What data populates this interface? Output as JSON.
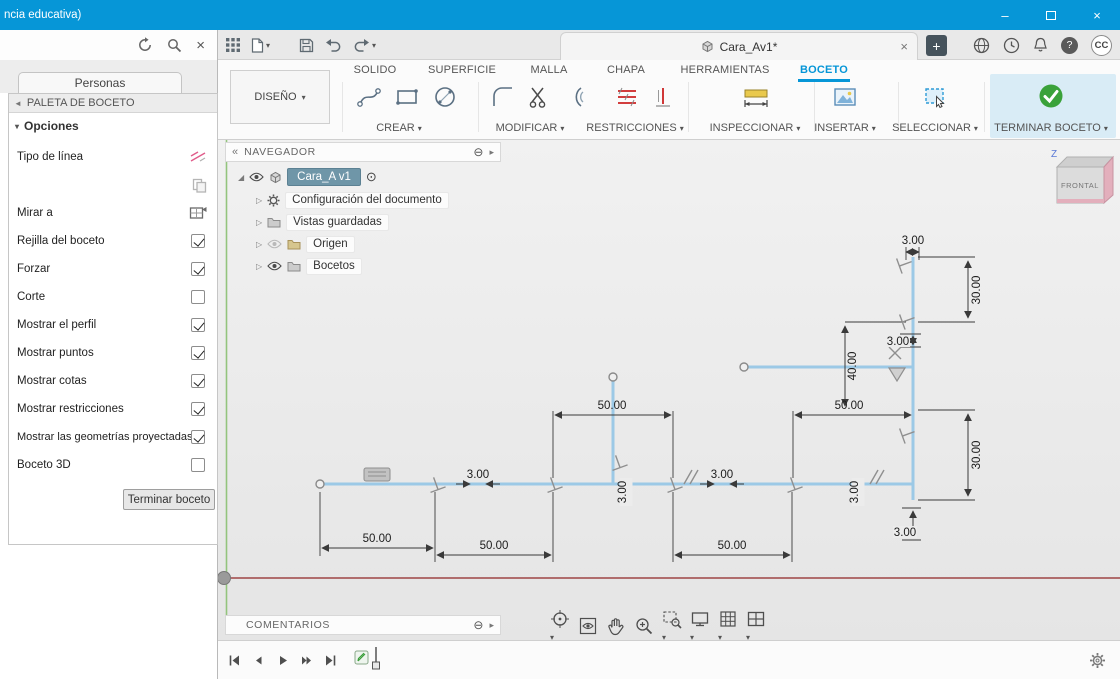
{
  "window": {
    "title": "ncia educativa)"
  },
  "left_panel": {
    "people_tab": "Personas",
    "palette": {
      "header": "PALETA DE BOCETO",
      "section": "Opciones",
      "rows": [
        {
          "label": "Tipo de línea",
          "type": "icon",
          "icon": "line-type-icon"
        },
        {
          "label": "",
          "type": "icon",
          "icon": "construction-icon"
        },
        {
          "label": "Mirar a",
          "type": "icon",
          "icon": "look-at-icon"
        },
        {
          "label": "Rejilla del boceto",
          "type": "checkbox",
          "checked": true
        },
        {
          "label": "Forzar",
          "type": "checkbox",
          "checked": true
        },
        {
          "label": "Corte",
          "type": "checkbox",
          "checked": false
        },
        {
          "label": "Mostrar el perfil",
          "type": "checkbox",
          "checked": true
        },
        {
          "label": "Mostrar puntos",
          "type": "checkbox",
          "checked": true
        },
        {
          "label": "Mostrar cotas",
          "type": "checkbox",
          "checked": true
        },
        {
          "label": "Mostrar restricciones",
          "type": "checkbox",
          "checked": true
        },
        {
          "label": "Mostrar las geometrías proyectadas",
          "type": "checkbox",
          "checked": true
        },
        {
          "label": "Boceto 3D",
          "type": "checkbox",
          "checked": false
        }
      ],
      "finish_button": "Terminar boceto"
    }
  },
  "tab_bar": {
    "document_tab": "Cara_Av1*",
    "new_tab": "+",
    "help": "?",
    "avatar": "CC"
  },
  "ribbon": {
    "design_menu": "DISEÑO",
    "tabs": [
      {
        "label": "SOLIDO"
      },
      {
        "label": "SUPERFICIE"
      },
      {
        "label": "MALLA"
      },
      {
        "label": "CHAPA"
      },
      {
        "label": "HERRAMIENTAS"
      },
      {
        "label": "BOCETO",
        "active": true
      }
    ],
    "groups": [
      {
        "label": "CREAR"
      },
      {
        "label": "MODIFICAR"
      },
      {
        "label": "RESTRICCIONES"
      },
      {
        "label": "INSPECCIONAR"
      },
      {
        "label": "INSERTAR"
      },
      {
        "label": "SELECCIONAR"
      },
      {
        "label": "TERMINAR BOCETO"
      }
    ]
  },
  "navigator": {
    "header": "NAVEGADOR",
    "root_item": "Cara_A v1",
    "items": [
      {
        "label": "Configuración del documento"
      },
      {
        "label": "Vistas guardadas"
      },
      {
        "label": "Origen"
      },
      {
        "label": "Bocetos"
      }
    ]
  },
  "viewcube": {
    "face": "FRONTAL",
    "axis": "Z"
  },
  "comments_bar": {
    "header": "COMENTARIOS"
  },
  "sketch": {
    "dims": {
      "top3": "3.00",
      "right30_top": "30.00",
      "step3": "3.00",
      "v40": "40.00",
      "h50_right": "50.00",
      "right30_bottom": "30.00",
      "h50_mid": "50.00",
      "inline3_a": "3.00",
      "inline3_b": "3.00",
      "inline3_c": "3.00",
      "inline3_d": "3.00",
      "bottom3": "3.00",
      "b50_1": "50.00",
      "b50_2": "50.00",
      "b50_3": "50.00"
    }
  },
  "colors": {
    "titlebar": "#0696d7",
    "accent": "#0696d7",
    "sketch_line": "#9cc9e6",
    "axis_x": "#9e4545",
    "axis_y": "#93c47d",
    "finish_green": "#3aa23a",
    "selection": "#6f96a8"
  }
}
